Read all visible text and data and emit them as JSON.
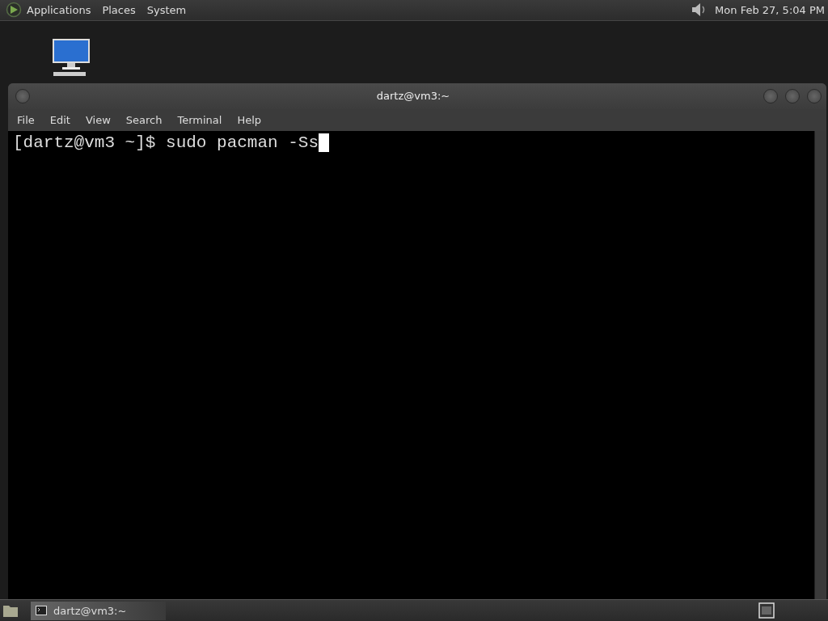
{
  "top_panel": {
    "menus": [
      "Applications",
      "Places",
      "System"
    ],
    "clock": "Mon Feb 27,  5:04 PM"
  },
  "window": {
    "title": "dartz@vm3:~",
    "menu": [
      "File",
      "Edit",
      "View",
      "Search",
      "Terminal",
      "Help"
    ],
    "terminal": {
      "prompt": "[dartz@vm3 ~]$ sudo pacman -Ss"
    }
  },
  "bottom_panel": {
    "tasks": [
      {
        "label": "dartz@vm3:~",
        "selected": true
      }
    ]
  }
}
